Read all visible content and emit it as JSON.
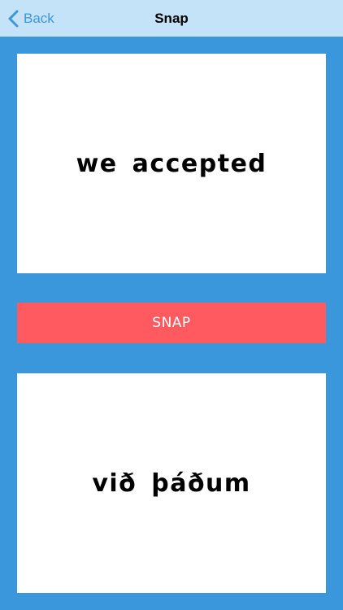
{
  "nav": {
    "back_label": "Back",
    "title": "Snap",
    "back_icon": "chevron-left-icon"
  },
  "cards": {
    "top_word": "we accepted",
    "bottom_word": "við þáðum"
  },
  "snap": {
    "label": "SNAP"
  },
  "colors": {
    "background": "#3a97dc",
    "nav_background": "#c5e3f8",
    "accent": "#3a97dc",
    "snap_button": "#ff5a60",
    "card": "#ffffff"
  }
}
